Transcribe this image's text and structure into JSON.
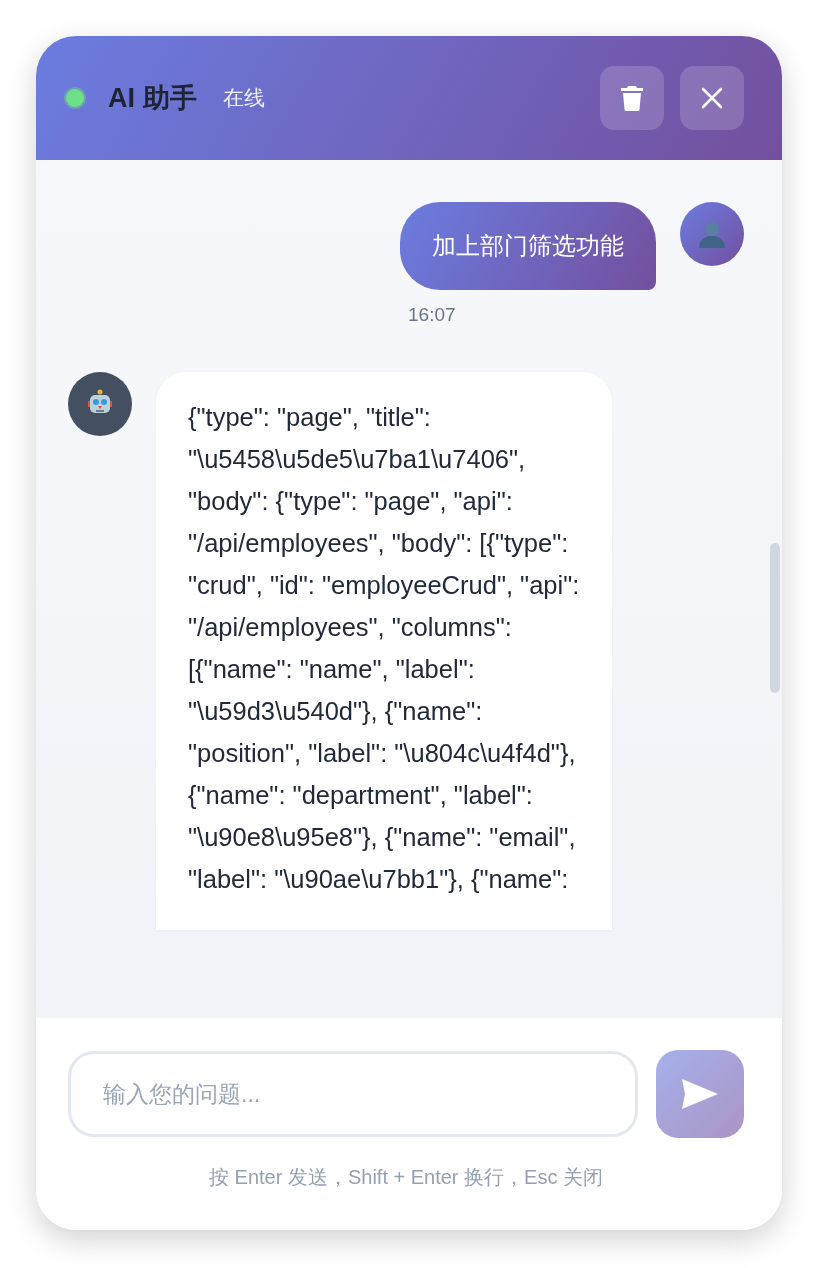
{
  "header": {
    "title": "AI 助手",
    "status": "在线",
    "online": true
  },
  "messages": [
    {
      "kind": "user",
      "text": "加上部门筛选功能",
      "time": "16:07"
    },
    {
      "kind": "bot",
      "text": "{\"type\": \"page\", \"title\": \"\\u5458\\u5de5\\u7ba1\\u7406\", \"body\": {\"type\": \"page\", \"api\": \"/api/employees\", \"body\": [{\"type\": \"crud\", \"id\": \"employeeCrud\", \"api\": \"/api/employees\", \"columns\": [{\"name\": \"name\", \"label\": \"\\u59d3\\u540d\"}, {\"name\": \"position\", \"label\": \"\\u804c\\u4f4d\"}, {\"name\": \"department\", \"label\": \"\\u90e8\\u95e8\"}, {\"name\": \"email\", \"label\": \"\\u90ae\\u7bb1\"}, {\"name\":"
    }
  ],
  "input": {
    "placeholder": "输入您的问题..."
  },
  "send": {
    "disabled": true
  },
  "hint": "按 Enter 发送，Shift + Enter 换行，Esc 关闭"
}
